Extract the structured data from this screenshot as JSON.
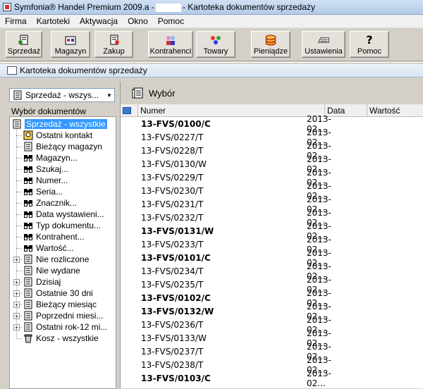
{
  "titlebar": {
    "title_left": "Symfonia® Handel Premium 2009.a -",
    "title_right": "- Kartoteka dokumentów sprzedaży"
  },
  "menu": [
    "Firma",
    "Kartoteki",
    "Aktywacja",
    "Okno",
    "Pomoc"
  ],
  "toolbar": [
    {
      "id": "sprzedaz",
      "label": "Sprzedaż",
      "icon": "sales-document-icon"
    },
    {
      "id": "magazyn",
      "label": "Magazyn",
      "icon": "warehouse-icon"
    },
    {
      "id": "zakup",
      "label": "Zakup",
      "icon": "purchase-icon"
    },
    {
      "id": "kontrahenci",
      "label": "Kontrahenci",
      "icon": "contractors-icon"
    },
    {
      "id": "towary",
      "label": "Towary",
      "icon": "goods-icon"
    },
    {
      "id": "pieniadze",
      "label": "Pieniądze",
      "icon": "money-icon"
    },
    {
      "id": "ustawienia",
      "label": "Ustawienia",
      "icon": "settings-keyboard-icon"
    },
    {
      "id": "pomoc",
      "label": "Pomoc",
      "icon": "help-icon"
    }
  ],
  "window": {
    "title": "Kartoteka dokumentów sprzedaży"
  },
  "left": {
    "combo_value": "Sprzedaż - wszys...",
    "tree_caption": "Wybór dokumentów",
    "tree": [
      {
        "label": "Sprzedaż - wszystkie",
        "level": 0,
        "selected": true,
        "icon": "list-icon"
      },
      {
        "label": "Ostatni kontakt",
        "level": 1,
        "icon": "contact-icon"
      },
      {
        "label": "Bieżący magazyn",
        "level": 1,
        "icon": "list-icon"
      },
      {
        "label": "Magazyn...",
        "level": 1,
        "icon": "binoculars-icon"
      },
      {
        "label": "Szukaj...",
        "level": 1,
        "icon": "binoculars-icon"
      },
      {
        "label": "Numer...",
        "level": 1,
        "icon": "binoculars-icon"
      },
      {
        "label": "Seria...",
        "level": 1,
        "icon": "binoculars-icon"
      },
      {
        "label": "Znacznik...",
        "level": 1,
        "icon": "binoculars-icon"
      },
      {
        "label": "Data wystawieni...",
        "level": 1,
        "icon": "binoculars-icon"
      },
      {
        "label": "Typ dokumentu...",
        "level": 1,
        "icon": "binoculars-icon"
      },
      {
        "label": "Kontrahent...",
        "level": 1,
        "icon": "binoculars-icon"
      },
      {
        "label": "Wartość...",
        "level": 1,
        "icon": "binoculars-icon"
      },
      {
        "label": "Nie rozliczone",
        "level": 1,
        "expandable": true,
        "icon": "list-icon"
      },
      {
        "label": "Nie wydane",
        "level": 1,
        "icon": "list-icon"
      },
      {
        "label": "Dzisiaj",
        "level": 1,
        "expandable": true,
        "icon": "list-icon"
      },
      {
        "label": "Ostatnie 30 dni",
        "level": 1,
        "expandable": true,
        "icon": "list-icon"
      },
      {
        "label": "Bieżący miesiąc",
        "level": 1,
        "expandable": true,
        "icon": "list-icon"
      },
      {
        "label": "Poprzedni miesi...",
        "level": 1,
        "expandable": true,
        "icon": "list-icon"
      },
      {
        "label": "Ostatni rok-12 mi...",
        "level": 1,
        "expandable": true,
        "icon": "list-icon"
      },
      {
        "label": "Kosz - wszystkie",
        "level": 1,
        "icon": "trash-icon"
      }
    ]
  },
  "right": {
    "header_title": "Wybór",
    "columns": {
      "numer": "Numer",
      "data": "Data",
      "wartosc": "Wartość"
    },
    "rows": [
      {
        "numer": "13-FVS/0100/C",
        "data": "2013-02...",
        "bold": true
      },
      {
        "numer": "13-FVS/0227/T",
        "data": "2013-02...",
        "bold": false
      },
      {
        "numer": "13-FVS/0228/T",
        "data": "2013-02...",
        "bold": false
      },
      {
        "numer": "13-FVS/0130/W",
        "data": "2013-02...",
        "bold": false
      },
      {
        "numer": "13-FVS/0229/T",
        "data": "2013-02...",
        "bold": false
      },
      {
        "numer": "13-FVS/0230/T",
        "data": "2013-02...",
        "bold": false
      },
      {
        "numer": "13-FVS/0231/T",
        "data": "2013-02...",
        "bold": false
      },
      {
        "numer": "13-FVS/0232/T",
        "data": "2013-02...",
        "bold": false
      },
      {
        "numer": "13-FVS/0131/W",
        "data": "2013-02...",
        "bold": true
      },
      {
        "numer": "13-FVS/0233/T",
        "data": "2013-02...",
        "bold": false
      },
      {
        "numer": "13-FVS/0101/C",
        "data": "2013-02...",
        "bold": true
      },
      {
        "numer": "13-FVS/0234/T",
        "data": "2013-02...",
        "bold": false
      },
      {
        "numer": "13-FVS/0235/T",
        "data": "2013-02...",
        "bold": false
      },
      {
        "numer": "13-FVS/0102/C",
        "data": "2013-02...",
        "bold": true
      },
      {
        "numer": "13-FVS/0132/W",
        "data": "2013-02...",
        "bold": true
      },
      {
        "numer": "13-FVS/0236/T",
        "data": "2013-02...",
        "bold": false
      },
      {
        "numer": "13-FVS/0133/W",
        "data": "2013-02...",
        "bold": false
      },
      {
        "numer": "13-FVS/0237/T",
        "data": "2013-02...",
        "bold": false
      },
      {
        "numer": "13-FVS/0238/T",
        "data": "2013-02...",
        "bold": false
      },
      {
        "numer": "13-FVS/0103/C",
        "data": "2013-02...",
        "bold": true
      }
    ]
  }
}
